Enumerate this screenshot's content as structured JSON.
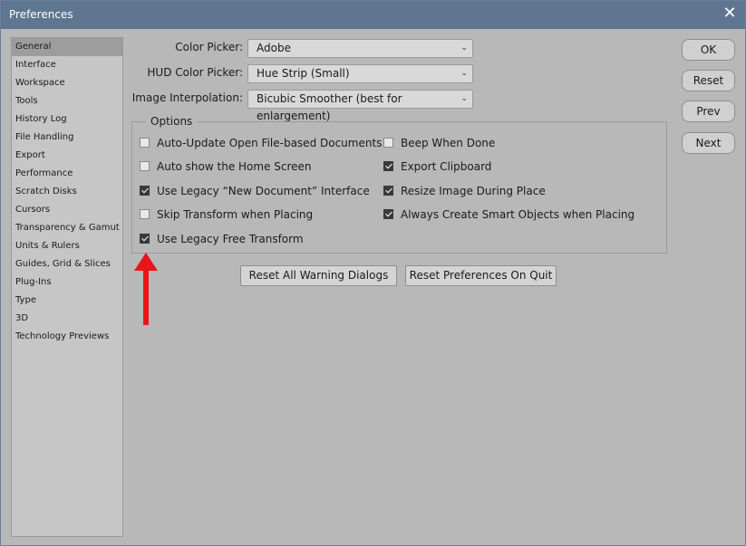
{
  "window": {
    "title": "Preferences",
    "close_label": "✕"
  },
  "sidebar": {
    "items": [
      {
        "label": "General"
      },
      {
        "label": "Interface"
      },
      {
        "label": "Workspace"
      },
      {
        "label": "Tools"
      },
      {
        "label": "History Log"
      },
      {
        "label": "File Handling"
      },
      {
        "label": "Export"
      },
      {
        "label": "Performance"
      },
      {
        "label": "Scratch Disks"
      },
      {
        "label": "Cursors"
      },
      {
        "label": "Transparency & Gamut"
      },
      {
        "label": "Units & Rulers"
      },
      {
        "label": "Guides, Grid & Slices"
      },
      {
        "label": "Plug-Ins"
      },
      {
        "label": "Type"
      },
      {
        "label": "3D"
      },
      {
        "label": "Technology Previews"
      }
    ],
    "selected": "General"
  },
  "fields": {
    "color_picker": {
      "label": "Color Picker:",
      "value": "Adobe"
    },
    "hud_color_picker": {
      "label": "HUD Color Picker:",
      "value": "Hue Strip (Small)"
    },
    "image_interpolation": {
      "label": "Image Interpolation:",
      "value": "Bicubic Smoother (best for enlargement)"
    }
  },
  "options": {
    "title": "Options",
    "left": [
      {
        "label": "Auto-Update Open File-based Documents",
        "checked": false
      },
      {
        "label": "Auto show the Home Screen",
        "checked": false
      },
      {
        "label": "Use Legacy “New Document” Interface",
        "checked": true
      },
      {
        "label": "Skip Transform when Placing",
        "checked": false
      },
      {
        "label": "Use Legacy Free Transform",
        "checked": true
      }
    ],
    "right": [
      {
        "label": "Beep When Done",
        "checked": false
      },
      {
        "label": "Export Clipboard",
        "checked": true
      },
      {
        "label": "Resize Image During Place",
        "checked": true
      },
      {
        "label": "Always Create Smart Objects when Placing",
        "checked": true
      }
    ]
  },
  "buttons": {
    "reset_warnings": "Reset All Warning Dialogs",
    "reset_on_quit": "Reset Preferences On Quit",
    "ok": "OK",
    "reset": "Reset",
    "prev": "Prev",
    "next": "Next"
  },
  "colors": {
    "titlebar": "#5f7691",
    "annotation_arrow": "#e8141a",
    "background": "#b8b8b8"
  },
  "icons": {
    "chevron": "chevron-down-icon",
    "arrow": "red-up-arrow-annotation"
  }
}
